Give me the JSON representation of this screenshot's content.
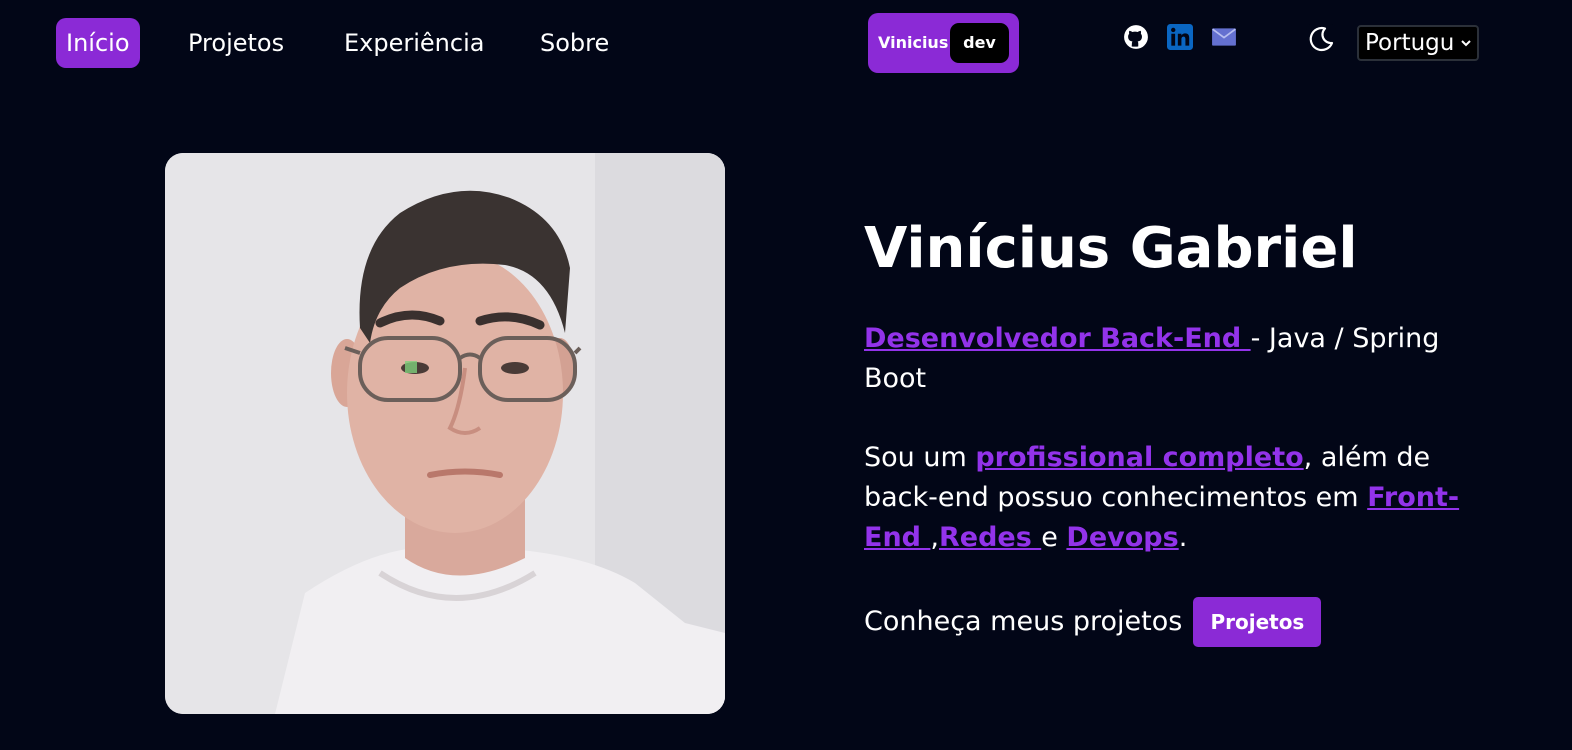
{
  "nav": {
    "items": [
      {
        "label": "Início",
        "active": true
      },
      {
        "label": "Projetos",
        "active": false
      },
      {
        "label": "Experiência",
        "active": false
      },
      {
        "label": "Sobre",
        "active": false
      }
    ],
    "brand": {
      "name": "Vinicius",
      "tag": "dev"
    },
    "social_icons": [
      "github-icon",
      "linkedin-icon",
      "mail-icon"
    ],
    "theme_icon": "moon-icon",
    "language": {
      "selected": "Portugu"
    }
  },
  "hero": {
    "name": "Vinícius Gabriel",
    "role_link": "Desenvolvedor Back-End ",
    "role_rest": "- Java / Spring Boot",
    "bio_intro": "Sou um ",
    "bio_link": "profissional completo",
    "bio_mid": ", além de back-end possuo conhecimentos em ",
    "bio_frontend": "Front-End ",
    "bio_comma": ",",
    "bio_redes": "Redes ",
    "bio_e": "e ",
    "bio_devops": "Devops",
    "bio_end": ".",
    "cta_text": "Conheça meus projetos",
    "cta_button": "Projetos"
  },
  "colors": {
    "background": "#020617",
    "accent": "#8b2ad6",
    "link": "#9333ea",
    "linkedin": "#0a66c2",
    "mail": "#6470d0"
  }
}
